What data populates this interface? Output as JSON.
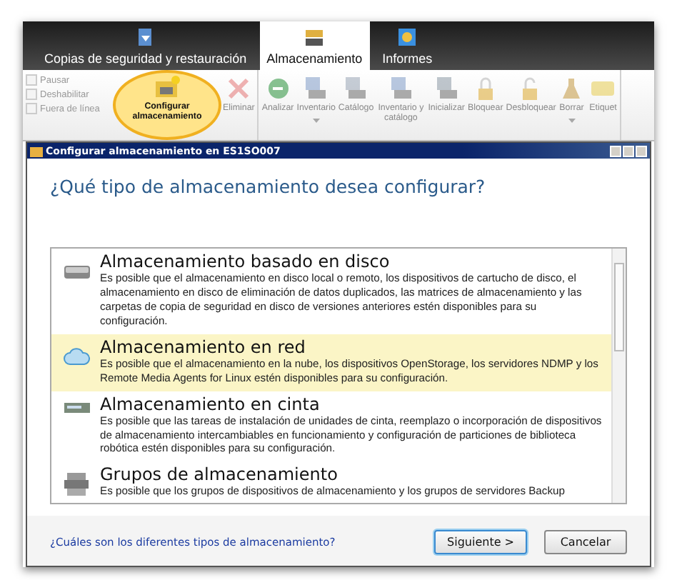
{
  "tabs": [
    {
      "label": "Copias de seguridad y restauración",
      "selected": false
    },
    {
      "label": "Almacenamiento",
      "selected": true
    },
    {
      "label": "Informes",
      "selected": false
    }
  ],
  "toolbar": {
    "checks": [
      {
        "label": "Pausar",
        "checked": false,
        "disabled": true
      },
      {
        "label": "Deshabilitar",
        "checked": false,
        "disabled": true
      },
      {
        "label": "Fuera de línea",
        "checked": false,
        "disabled": true
      }
    ],
    "groups": [
      [
        {
          "label": "Configurar almacenamiento",
          "disabled": false,
          "highlighted": true,
          "dropdown": false
        },
        {
          "label": "Eliminar",
          "disabled": true,
          "highlighted": false,
          "dropdown": false
        }
      ],
      [
        {
          "label": "Analizar",
          "disabled": true,
          "highlighted": false,
          "dropdown": false
        },
        {
          "label": "Inventario",
          "disabled": true,
          "highlighted": false,
          "dropdown": true
        },
        {
          "label": "Catálogo",
          "disabled": true,
          "highlighted": false,
          "dropdown": false
        },
        {
          "label": "Inventario y catálogo",
          "disabled": true,
          "highlighted": false,
          "dropdown": false
        },
        {
          "label": "Inicializar",
          "disabled": true,
          "highlighted": false,
          "dropdown": false
        },
        {
          "label": "Bloquear",
          "disabled": true,
          "highlighted": false,
          "dropdown": false
        },
        {
          "label": "Desbloquear",
          "disabled": true,
          "highlighted": false,
          "dropdown": false
        },
        {
          "label": "Borrar",
          "disabled": true,
          "highlighted": false,
          "dropdown": true
        },
        {
          "label": "Etiquet",
          "disabled": true,
          "highlighted": false,
          "dropdown": false
        }
      ]
    ]
  },
  "dialog": {
    "title": "Configurar almacenamiento en ES1SO007",
    "question": "¿Qué tipo de almacenamiento desea configurar?",
    "options": [
      {
        "kind": "disk",
        "title": "Almacenamiento basado en disco",
        "description": "Es posible que el almacenamiento en disco local o remoto, los dispositivos de cartucho de disco, el almacenamiento en disco de eliminación de datos duplicados, las matrices de almacenamiento y las carpetas de copia de seguridad en disco de versiones anteriores estén disponibles para su configuración.",
        "selected": false
      },
      {
        "kind": "cloud",
        "title": "Almacenamiento en red",
        "description": "Es posible que el almacenamiento en la nube, los dispositivos OpenStorage, los servidores NDMP y los Remote Media Agents for Linux estén disponibles para su configuración.",
        "selected": true
      },
      {
        "kind": "tape",
        "title": "Almacenamiento en cinta",
        "description": "Es posible que las tareas de instalación de unidades de cinta, reemplazo o incorporación de dispositivos de almacenamiento intercambiables en funcionamiento y configuración de particiones de biblioteca robótica estén disponibles para su configuración.",
        "selected": false
      },
      {
        "kind": "group",
        "title": "Grupos de almacenamiento",
        "description": "Es posible que los grupos de dispositivos de almacenamiento y los grupos de servidores Backup",
        "selected": false
      }
    ],
    "help_link": "¿Cuáles son los diferentes tipos de almacenamiento?",
    "buttons": [
      {
        "label": "Siguiente >",
        "default": true
      },
      {
        "label": "Cancelar",
        "default": false
      }
    ]
  }
}
